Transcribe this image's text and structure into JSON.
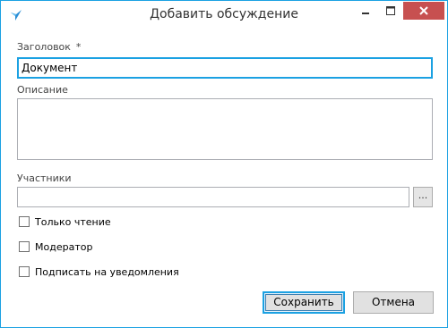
{
  "window": {
    "title": "Добавить обсуждение"
  },
  "form": {
    "title_label": "Заголовок",
    "required_marker": "*",
    "title_value": "Документ",
    "description_label": "Описание",
    "description_value": "",
    "participants_label": "Участники",
    "participants_value": "",
    "browse_label": "..."
  },
  "options": {
    "read_only_label": "Только чтение",
    "moderator_label": "Модератор",
    "subscribe_label": "Подписать на уведомления"
  },
  "buttons": {
    "save_label": "Сохранить",
    "cancel_label": "Отмена"
  },
  "colors": {
    "accent": "#1ba1e2",
    "close_button": "#c75050"
  },
  "icons": {
    "app": "bird-logo-icon",
    "minimize": "minimize-icon",
    "maximize": "maximize-icon",
    "close": "close-icon"
  }
}
